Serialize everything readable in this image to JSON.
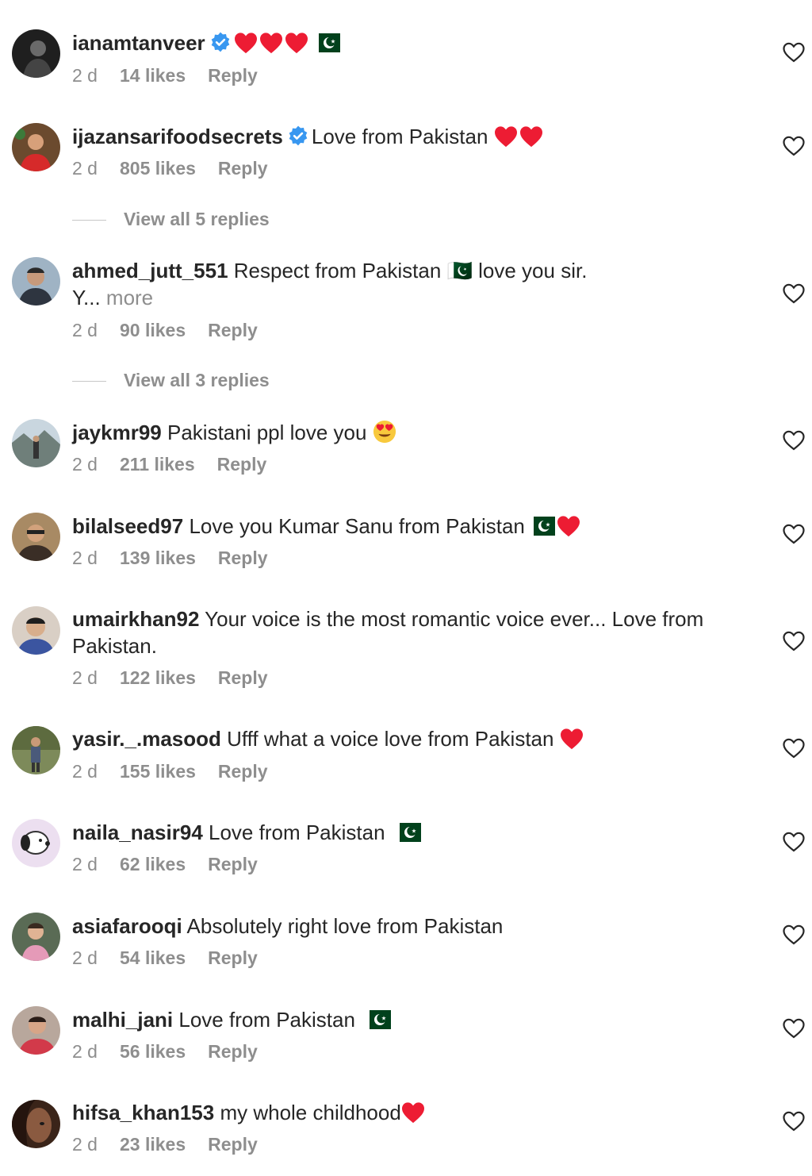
{
  "comments": [
    {
      "username": "ianamtanveer",
      "verified": true,
      "text": "",
      "emojis": "❤️❤️❤️🇵🇰",
      "time": "2 d",
      "likes": "14 likes",
      "reply": "Reply",
      "avatar_color": "#2b2b2b"
    },
    {
      "username": "ijazansarifoodsecrets",
      "verified": true,
      "text": "Love from Pakistan",
      "emojis": "❤️❤️",
      "time": "2 d",
      "likes": "805 likes",
      "reply": "Reply",
      "view_replies": "View all 5 replies",
      "avatar_color": "#b33a2a"
    },
    {
      "username": "ahmed_jutt_551",
      "verified": false,
      "text": "Respect from Pakistan 🇵🇰 love you sir.",
      "text_line2": "Y...",
      "more": "more",
      "time": "2 d",
      "likes": "90 likes",
      "reply": "Reply",
      "view_replies": "View all 3 replies",
      "avatar_color": "#3d4a5a"
    },
    {
      "username": "jaykmr99",
      "verified": false,
      "text": "Pakistani ppl love you",
      "emojis": "😍",
      "time": "2 d",
      "likes": "211 likes",
      "reply": "Reply",
      "avatar_color": "#7a8ea0"
    },
    {
      "username": "bilalseed97",
      "verified": false,
      "text": "Love you Kumar Sanu from Pakistan",
      "emojis": "🇵🇰❤️",
      "time": "2 d",
      "likes": "139 likes",
      "reply": "Reply",
      "avatar_color": "#8a7050"
    },
    {
      "username": "umairkhan92",
      "verified": false,
      "text": "Your voice is the most romantic voice ever... Love from Pakistan.",
      "time": "2 d",
      "likes": "122 likes",
      "reply": "Reply",
      "avatar_color": "#a08b7a"
    },
    {
      "username": "yasir._.masood",
      "verified": false,
      "text": "Ufff what a voice love from Pakistan",
      "emojis": "❤️",
      "time": "2 d",
      "likes": "155 likes",
      "reply": "Reply",
      "avatar_color": "#6d7a55"
    },
    {
      "username": "naila_nasir94",
      "verified": false,
      "text": "Love from Pakistan",
      "emojis": "🇵🇰",
      "time": "2 d",
      "likes": "62 likes",
      "reply": "Reply",
      "avatar_color": "#e7d8e8"
    },
    {
      "username": "asiafarooqi",
      "verified": false,
      "text": "Absolutely right love from Pakistan",
      "time": "2 d",
      "likes": "54 likes",
      "reply": "Reply",
      "avatar_color": "#c9a48e"
    },
    {
      "username": "malhi_jani",
      "verified": false,
      "text": "Love from Pakistan",
      "emojis": "🇵🇰",
      "time": "2 d",
      "likes": "56 likes",
      "reply": "Reply",
      "avatar_color": "#c44a55"
    },
    {
      "username": "hifsa_khan153",
      "verified": false,
      "text": "my whole childhood",
      "emojis": "❤️",
      "time": "2 d",
      "likes": "23 likes",
      "reply": "Reply",
      "avatar_color": "#4a2e22"
    }
  ],
  "colors": {
    "verified": "#3897f0",
    "heart_red": "#ed1c33",
    "flag_green": "#01411c",
    "muted": "#8e8e8e",
    "text": "#262626"
  }
}
